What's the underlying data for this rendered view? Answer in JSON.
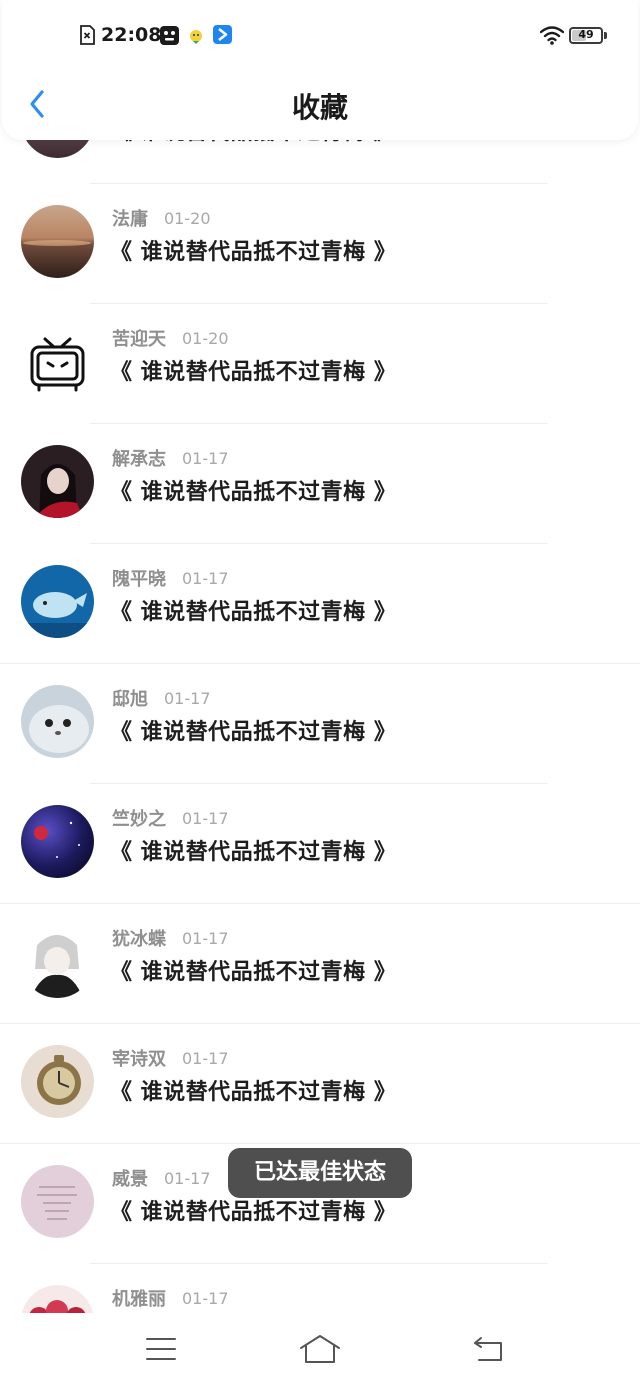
{
  "status_bar": {
    "time": "22:08",
    "battery_level": "49",
    "battery_fraction": 0.49,
    "icons": [
      "sim-card-icon",
      "app-notification-icon",
      "emoji-notification-icon",
      "arrow-app-icon",
      "wifi-icon",
      "battery-icon"
    ]
  },
  "header": {
    "title": "收藏",
    "back_icon": "chevron-left-icon",
    "accent_color": "#2b8ef0"
  },
  "items": [
    {
      "name": "",
      "date": "",
      "title": "《 谁说替代品抵不过青梅 》"
    },
    {
      "name": "法庸",
      "date": "01-20",
      "title": "《 谁说替代品抵不过青梅 》"
    },
    {
      "name": "苦迎天",
      "date": "01-20",
      "title": "《 谁说替代品抵不过青梅 》"
    },
    {
      "name": "解承志",
      "date": "01-17",
      "title": "《 谁说替代品抵不过青梅 》"
    },
    {
      "name": "隗平晓",
      "date": "01-17",
      "title": "《 谁说替代品抵不过青梅 》"
    },
    {
      "name": "邸旭",
      "date": "01-17",
      "title": "《 谁说替代品抵不过青梅 》"
    },
    {
      "name": "竺妙之",
      "date": "01-17",
      "title": "《 谁说替代品抵不过青梅 》"
    },
    {
      "name": "犹冰蝶",
      "date": "01-17",
      "title": "《 谁说替代品抵不过青梅 》"
    },
    {
      "name": "宰诗双",
      "date": "01-17",
      "title": "《 谁说替代品抵不过青梅 》"
    },
    {
      "name": "威景",
      "date": "01-17",
      "title": "《 谁说替代品抵不过青梅 》"
    },
    {
      "name": "机雅丽",
      "date": "01-17",
      "title": ""
    }
  ],
  "toast": {
    "text": "已达最佳状态"
  },
  "bottom_nav": {
    "menu_icon": "menu-icon",
    "home_icon": "home-icon",
    "back_icon": "return-icon"
  }
}
